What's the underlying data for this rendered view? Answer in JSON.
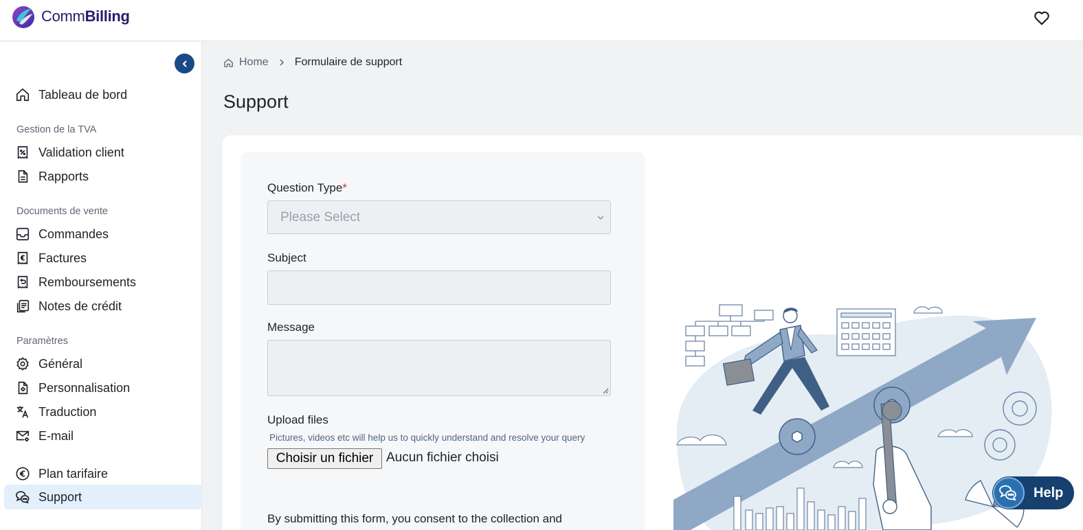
{
  "app": {
    "logo_icon": "commbilling-logo",
    "brand_prefix": "Comm",
    "brand_suffix": "Billing",
    "brand_color": "#2a1b6b",
    "favorites_icon": "heart-icon"
  },
  "sidebar": {
    "collapse_icon": "chevron-left-icon",
    "dashboard": {
      "label": "Tableau de bord",
      "icon": "home-icon"
    },
    "sections": [
      {
        "title": "Gestion de la TVA",
        "items": [
          {
            "label": "Validation client",
            "icon": "receipt-percent-icon"
          },
          {
            "label": "Rapports",
            "icon": "document-icon"
          }
        ]
      },
      {
        "title": "Documents de vente",
        "items": [
          {
            "label": "Commandes",
            "icon": "inbox-icon"
          },
          {
            "label": "Factures",
            "icon": "euro-receipt-icon"
          },
          {
            "label": "Remboursements",
            "icon": "refund-receipt-icon"
          },
          {
            "label": "Notes de crédit",
            "icon": "credit-notes-icon"
          }
        ]
      },
      {
        "title": "Paramètres",
        "items": [
          {
            "label": "Général",
            "icon": "gear-icon"
          },
          {
            "label": "Personnalisation",
            "icon": "document-gear-icon"
          },
          {
            "label": "Traduction",
            "icon": "translate-icon"
          },
          {
            "label": "E-mail",
            "icon": "mail-gear-icon"
          }
        ]
      }
    ],
    "plan": {
      "label": "Plan tarifaire",
      "icon": "euro-circle-icon"
    },
    "support": {
      "label": "Support",
      "icon": "chat-bubbles-icon",
      "active": true
    },
    "active_color": "#e3effb"
  },
  "breadcrumb": {
    "home": "Home",
    "current": "Formulaire de support"
  },
  "page": {
    "title": "Support"
  },
  "form": {
    "question_type": {
      "label": "Question Type",
      "required_mark": "*",
      "placeholder": "Please Select"
    },
    "subject": {
      "label": "Subject",
      "value": ""
    },
    "message": {
      "label": "Message",
      "value": ""
    },
    "upload": {
      "label": "Upload files",
      "hint": "Pictures, videos etc will help us to quickly understand and resolve your query",
      "button": "Choisir un fichier",
      "status": "Aucun fichier choisi"
    },
    "consent_text": "By submitting this form, you consent to the collection and"
  },
  "help": {
    "label": "Help",
    "icon": "chat-bubbles-icon",
    "color": "#16406d"
  }
}
